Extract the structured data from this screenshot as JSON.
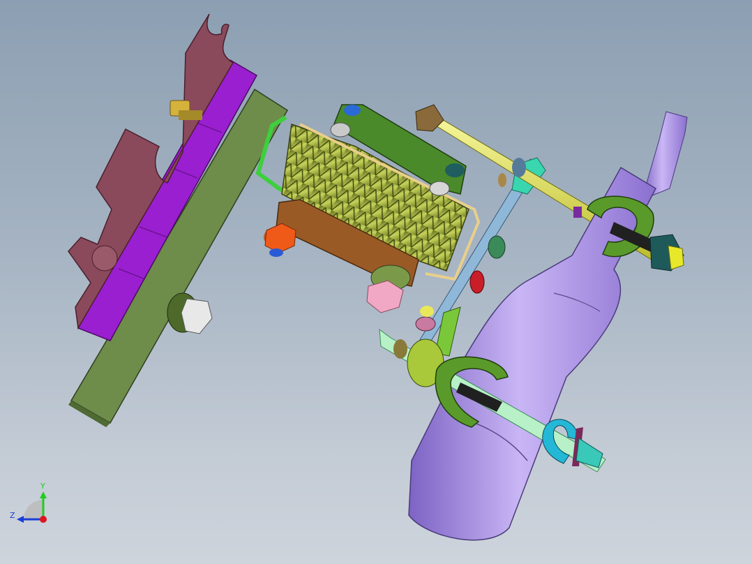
{
  "view": {
    "background_top": "#8c9fb2",
    "background_bottom": "#cdd4dc"
  },
  "triad": {
    "y_label": "Y",
    "z_label": "Z",
    "y_color": "#22cc22",
    "z_color": "#1a3fd6",
    "x_color": "#e0141e"
  },
  "parts": {
    "frame_plate_color": "#6e8c4a",
    "magenta_block_color": "#9a1fd0",
    "bracket_color": "#8a4a5c",
    "roller_color": "#9cab3a",
    "bottle_color": "#a98ae0",
    "yellow_rod_color": "#e8e84a",
    "link_color": "#4a8a2a",
    "brown_link_color": "#9a5a26"
  }
}
